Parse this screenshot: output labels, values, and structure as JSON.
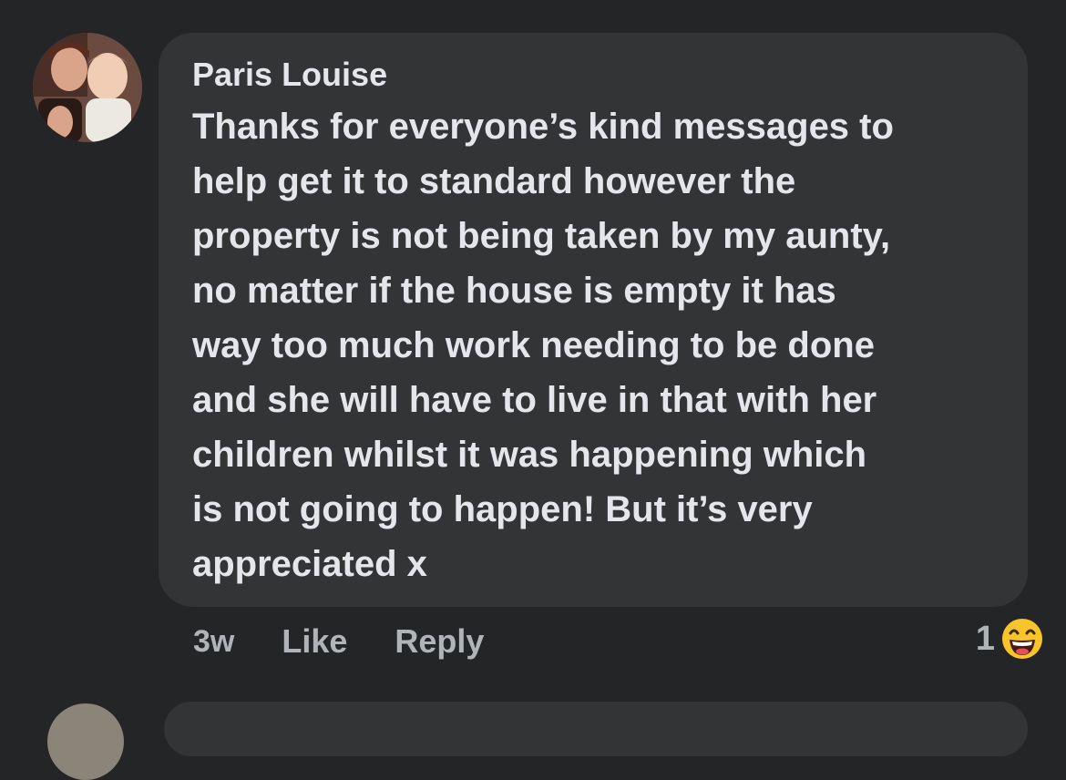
{
  "comment": {
    "author": "Paris Louise",
    "lines": [
      "Thanks for everyone’s kind messages to",
      "help get it to standard however the",
      "property is not being taken by my aunty,",
      "no matter if the house is empty it has",
      "way too much work needing to be done",
      "and she will have to live in that with her",
      "children whilst it was happening which",
      "is not going to happen! But it’s very",
      "appreciated x"
    ],
    "time": "3w",
    "like_label": "Like",
    "reply_label": "Reply",
    "reaction_count": "1",
    "reaction_icon": "haha-emoji-icon"
  },
  "colors": {
    "background": "#242527",
    "bubble": "#333436",
    "text_primary": "#e4e6eb",
    "text_secondary": "#b0b3b8",
    "emoji_yellow": "#f7c42b"
  }
}
